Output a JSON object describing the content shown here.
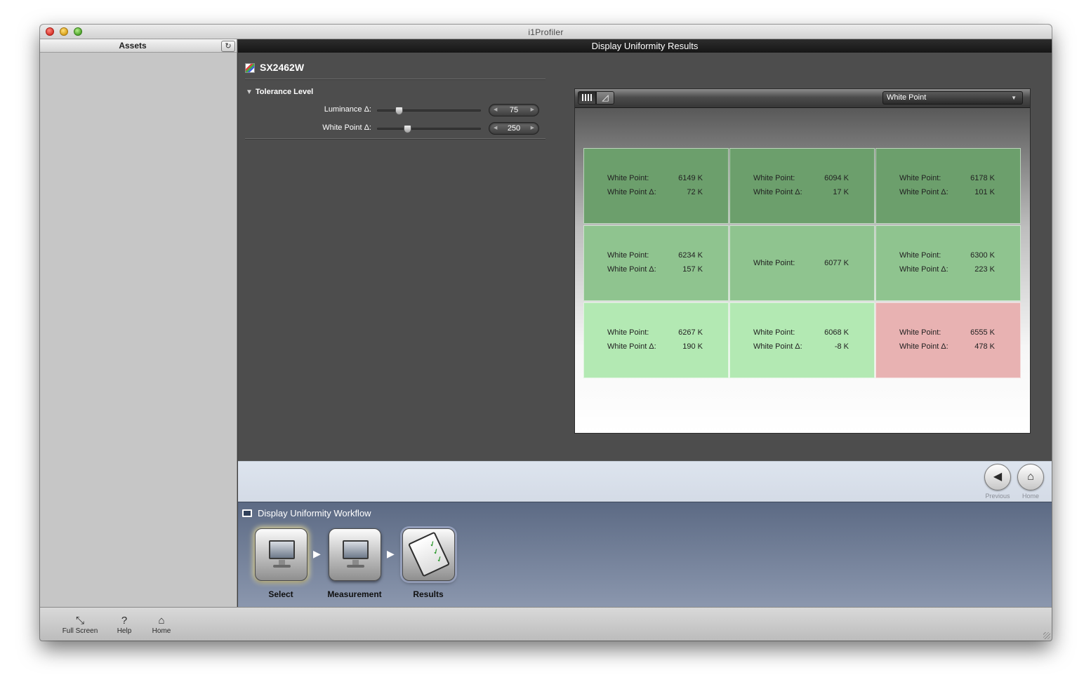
{
  "window": {
    "title": "i1Profiler"
  },
  "sidebar": {
    "title": "Assets"
  },
  "content": {
    "header": "Display Uniformity Results"
  },
  "device": {
    "name": "SX2462W"
  },
  "tolerance": {
    "section_label": "Tolerance Level",
    "luminance": {
      "label": "Luminance  Δ:",
      "value": "75",
      "fraction": 0.18
    },
    "white_point": {
      "label": "White Point  Δ:",
      "value": "250",
      "fraction": 0.27
    }
  },
  "results_panel": {
    "view_grid_icon": "grid-icon",
    "view_chart_icon": "chart-icon",
    "selected_metric": "White Point",
    "cells": [
      {
        "status": "pass-1",
        "wp_label": "White Point:",
        "wp_value": "6149 K",
        "delta_label": "White Point Δ:",
        "delta_value": "72 K"
      },
      {
        "status": "pass-1",
        "wp_label": "White Point:",
        "wp_value": "6094 K",
        "delta_label": "White Point Δ:",
        "delta_value": "17 K"
      },
      {
        "status": "pass-1",
        "wp_label": "White Point:",
        "wp_value": "6178 K",
        "delta_label": "White Point Δ:",
        "delta_value": "101 K"
      },
      {
        "status": "pass-2",
        "wp_label": "White Point:",
        "wp_value": "6234 K",
        "delta_label": "White Point Δ:",
        "delta_value": "157 K"
      },
      {
        "status": "pass-2",
        "wp_label": "White Point:",
        "wp_value": "6077 K",
        "delta_label": "",
        "delta_value": ""
      },
      {
        "status": "pass-2",
        "wp_label": "White Point:",
        "wp_value": "6300 K",
        "delta_label": "White Point Δ:",
        "delta_value": "223 K"
      },
      {
        "status": "pass-3",
        "wp_label": "White Point:",
        "wp_value": "6267 K",
        "delta_label": "White Point Δ:",
        "delta_value": "190 K"
      },
      {
        "status": "pass-3",
        "wp_label": "White Point:",
        "wp_value": "6068 K",
        "delta_label": "White Point Δ:",
        "delta_value": "-8 K"
      },
      {
        "status": "fail",
        "wp_label": "White Point:",
        "wp_value": "6555 K",
        "delta_label": "White Point Δ:",
        "delta_value": "478 K"
      }
    ]
  },
  "navigation": {
    "previous_label": "Previous",
    "home_label": "Home"
  },
  "workflow": {
    "title": "Display Uniformity Workflow",
    "steps": [
      {
        "label": "Select",
        "icon": "monitor-icon"
      },
      {
        "label": "Measurement",
        "icon": "measure-monitor-icon"
      },
      {
        "label": "Results",
        "icon": "clipboard-checklist-icon"
      }
    ]
  },
  "bottom_bar": {
    "full_screen": "Full Screen",
    "help": "Help",
    "home": "Home"
  }
}
